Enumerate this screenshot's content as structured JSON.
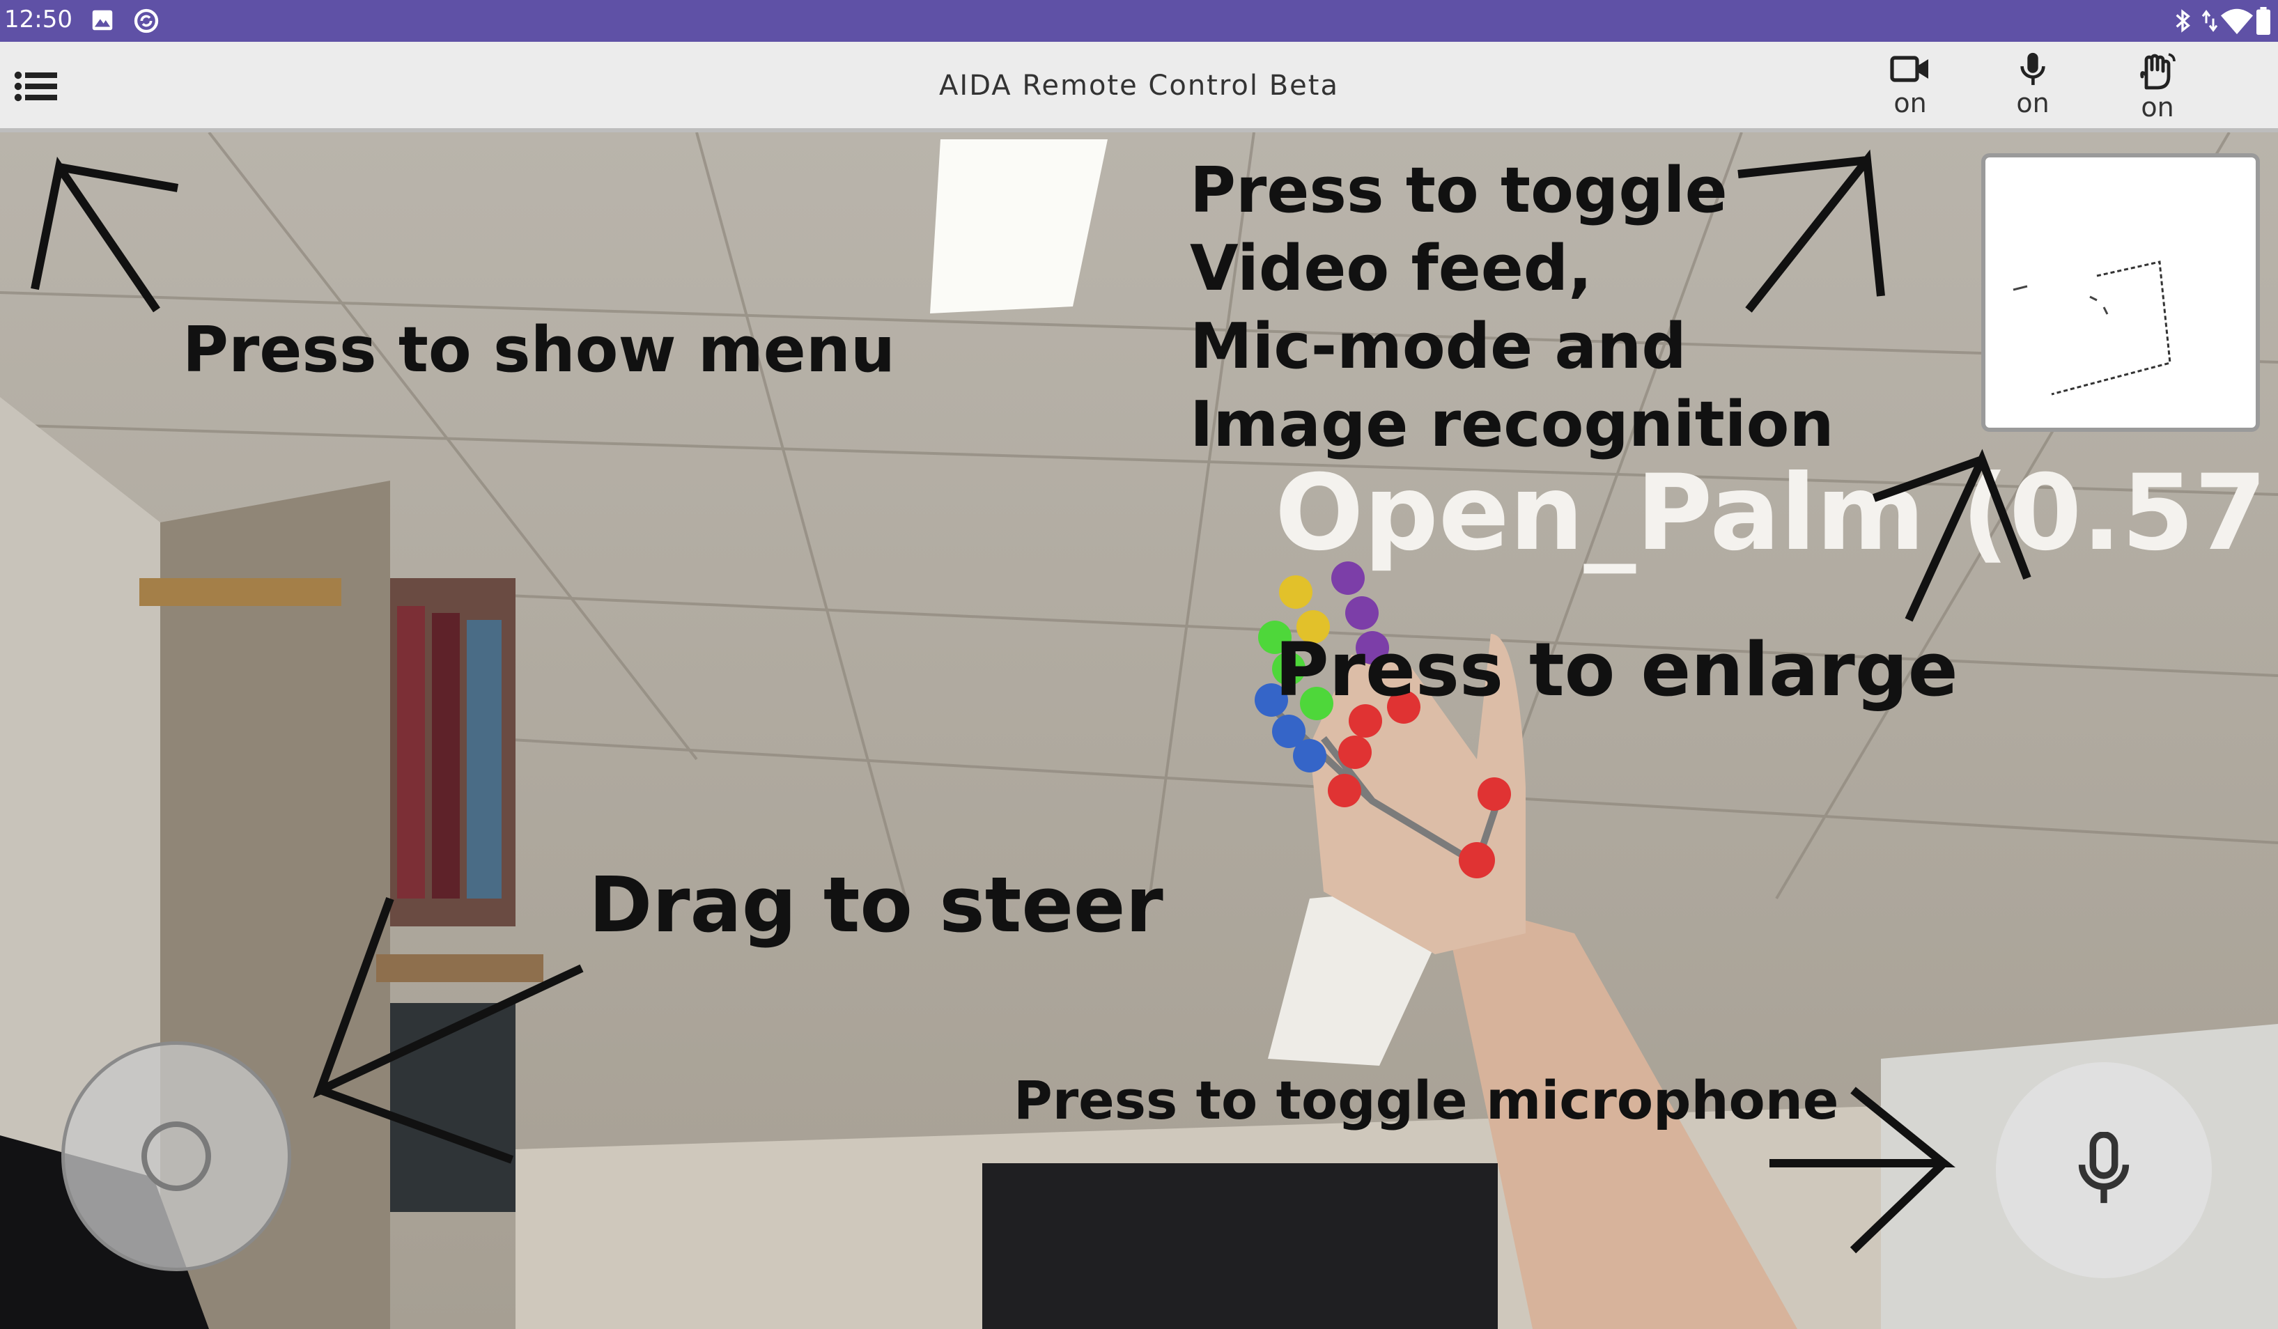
{
  "status_bar": {
    "time": "12:50",
    "left_icons": [
      "image-icon",
      "sync-circle-icon"
    ],
    "right_icons": [
      "bluetooth-icon",
      "data-arrows-icon",
      "wifi-icon",
      "battery-icon"
    ],
    "background_color": "#5f51a6"
  },
  "app_bar": {
    "title": "AIDA Remote Control Beta",
    "menu_icon": "menu-list-icon",
    "toggles": [
      {
        "icon": "video-camera-icon",
        "label": "on"
      },
      {
        "icon": "microphone-icon",
        "label": "on"
      },
      {
        "icon": "hand-gesture-icon",
        "label": "on"
      }
    ]
  },
  "camera": {
    "gesture_label": "Open_Palm (0.57"
  },
  "annotations": {
    "menu": "Press to show menu",
    "toggle_lines": [
      "Press to toggle",
      "Video feed,",
      "Mic-mode and",
      "Image recognition"
    ],
    "enlarge": "Press to enlarge",
    "steer": "Drag to steer",
    "microphone": "Press to toggle microphone"
  },
  "controls": {
    "joystick": "joystick",
    "mic_button_icon": "microphone-icon"
  }
}
